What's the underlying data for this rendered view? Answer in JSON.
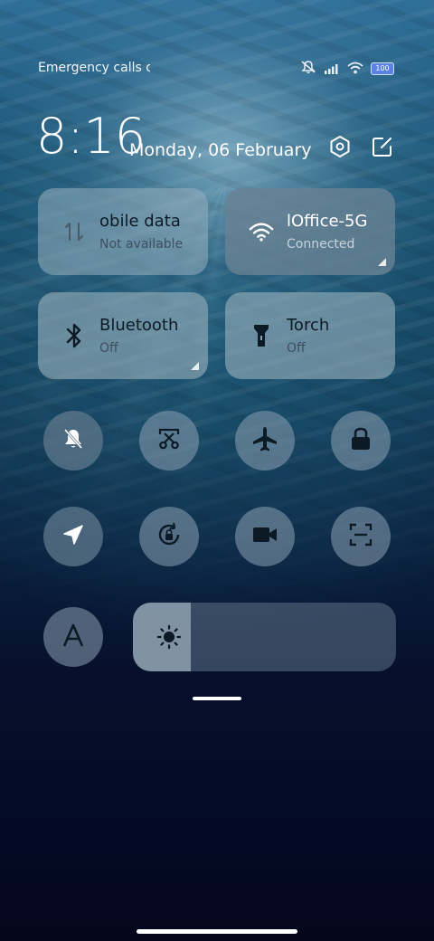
{
  "status_bar": {
    "carrier_text": "Emergency calls o",
    "battery": "100",
    "icons": [
      "silent-mode-icon",
      "signal-icon",
      "wifi-icon",
      "battery-icon"
    ]
  },
  "header": {
    "time": "8:16",
    "date": "Monday, 06 February",
    "buttons": [
      "settings-icon",
      "edit-icon"
    ]
  },
  "tiles": [
    {
      "title": "obile data",
      "subtitle": "Not available",
      "icon": "mobile-data-icon",
      "active": false
    },
    {
      "title": "lOffice-5G",
      "subtitle": "Connected",
      "icon": "wifi-icon",
      "active": true
    },
    {
      "title": "Bluetooth",
      "subtitle": "Off",
      "icon": "bluetooth-icon",
      "active": false
    },
    {
      "title": "Torch",
      "subtitle": "Off",
      "icon": "torch-icon",
      "active": false
    }
  ],
  "toggles": [
    {
      "name": "mute-notifications",
      "icon": "bell-off-icon",
      "active": true
    },
    {
      "name": "screenshot",
      "icon": "scissors-screen-icon",
      "active": false
    },
    {
      "name": "airplane-mode",
      "icon": "airplane-icon",
      "active": false
    },
    {
      "name": "lock-screen",
      "icon": "lock-icon",
      "active": false
    },
    {
      "name": "location",
      "icon": "location-arrow-icon",
      "active": true
    },
    {
      "name": "rotation-lock",
      "icon": "rotation-lock-icon",
      "active": false
    },
    {
      "name": "screen-recorder",
      "icon": "video-camera-icon",
      "active": false
    },
    {
      "name": "scanner",
      "icon": "scan-icon",
      "active": false
    },
    {
      "name": "reading-mode",
      "icon": "font-a-icon",
      "active": false
    }
  ],
  "brightness": {
    "icon": "sun-icon",
    "level": 0.22
  },
  "colors": {
    "tile": "#96afbe",
    "tile_active": "#69828f",
    "button_on": "#5f788c"
  }
}
